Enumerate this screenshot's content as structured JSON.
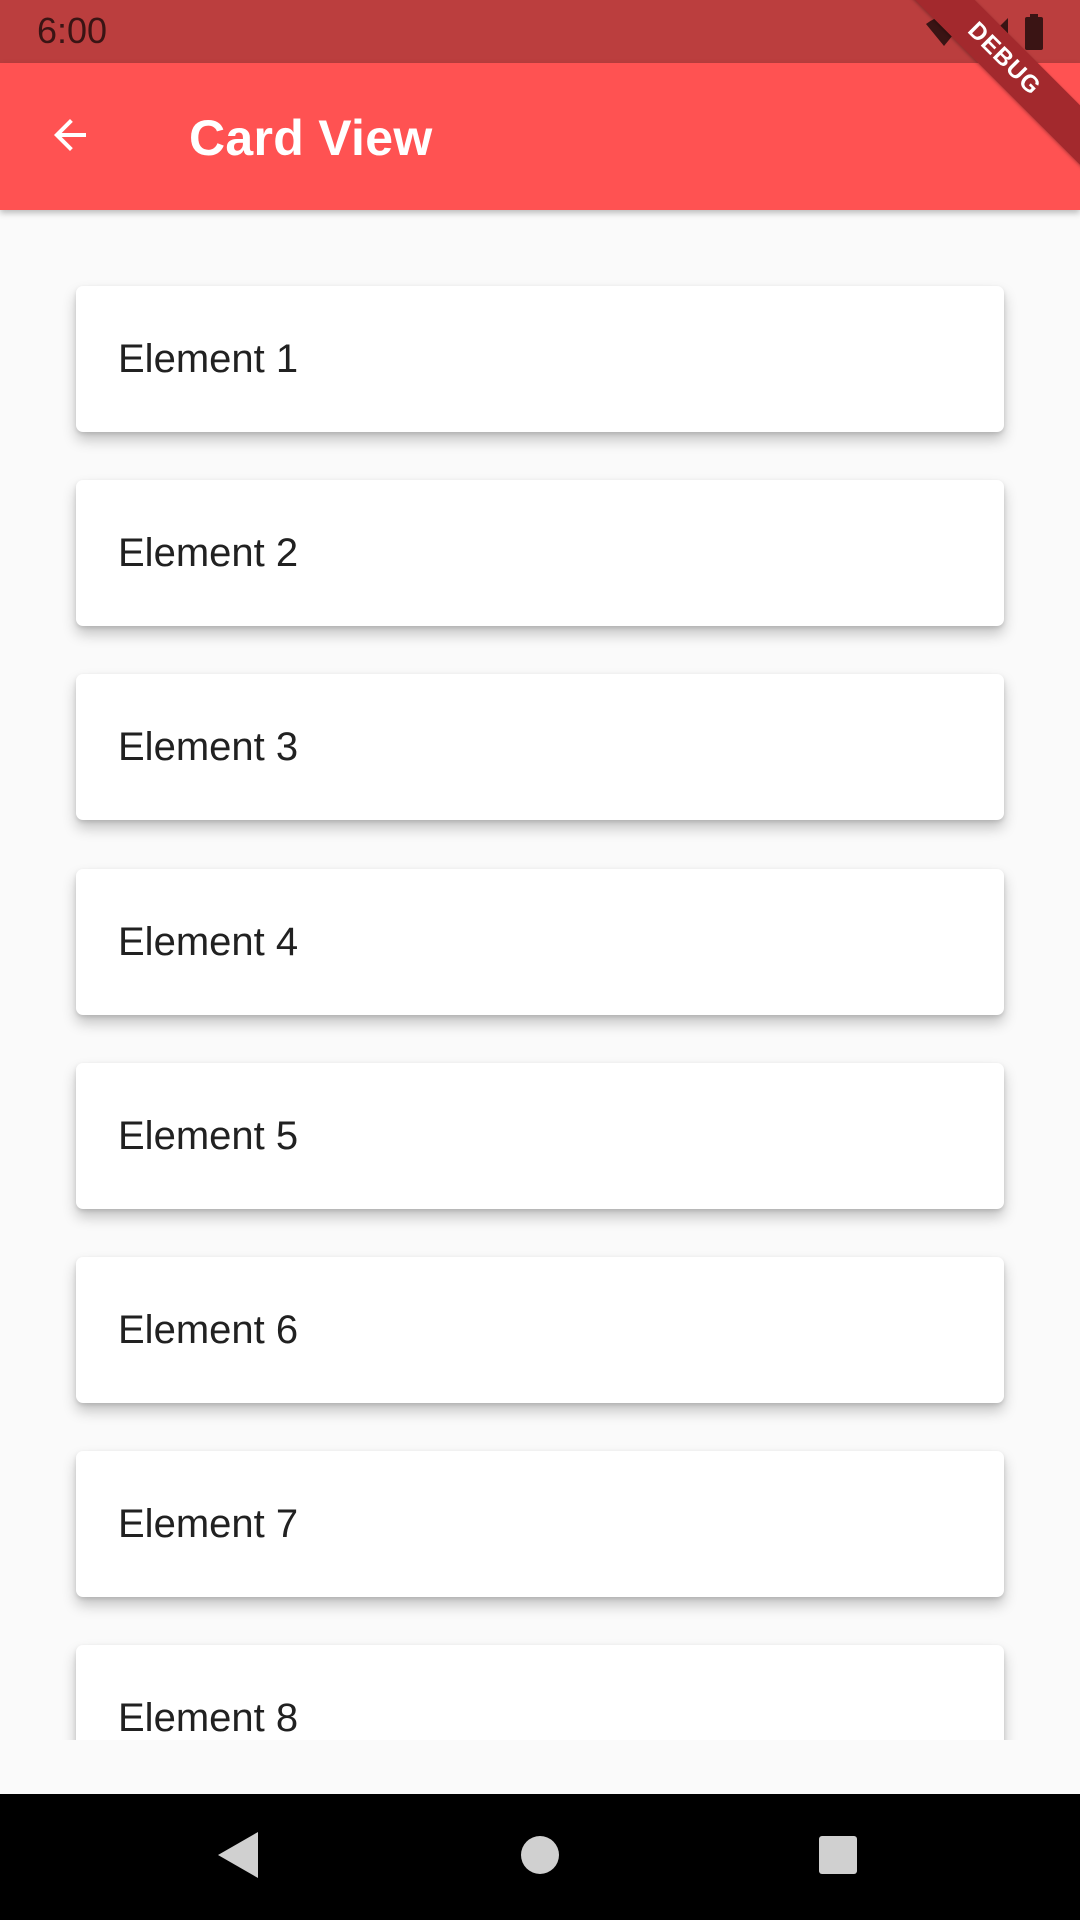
{
  "status_bar": {
    "time": "6:00",
    "icons": [
      "wifi-icon",
      "signal-icon",
      "battery-icon"
    ]
  },
  "app_bar": {
    "title": "Card View",
    "back_icon": "arrow-back-icon",
    "color": "#ff5252"
  },
  "debug_banner": "DEBUG",
  "cards": [
    {
      "label": "Element 1"
    },
    {
      "label": "Element 2"
    },
    {
      "label": "Element 3"
    },
    {
      "label": "Element 4"
    },
    {
      "label": "Element 5"
    },
    {
      "label": "Element 6"
    },
    {
      "label": "Element 7"
    },
    {
      "label": "Element 8"
    }
  ],
  "nav_bar": {
    "buttons": [
      "back-triangle-icon",
      "home-circle-icon",
      "recents-square-icon"
    ]
  }
}
